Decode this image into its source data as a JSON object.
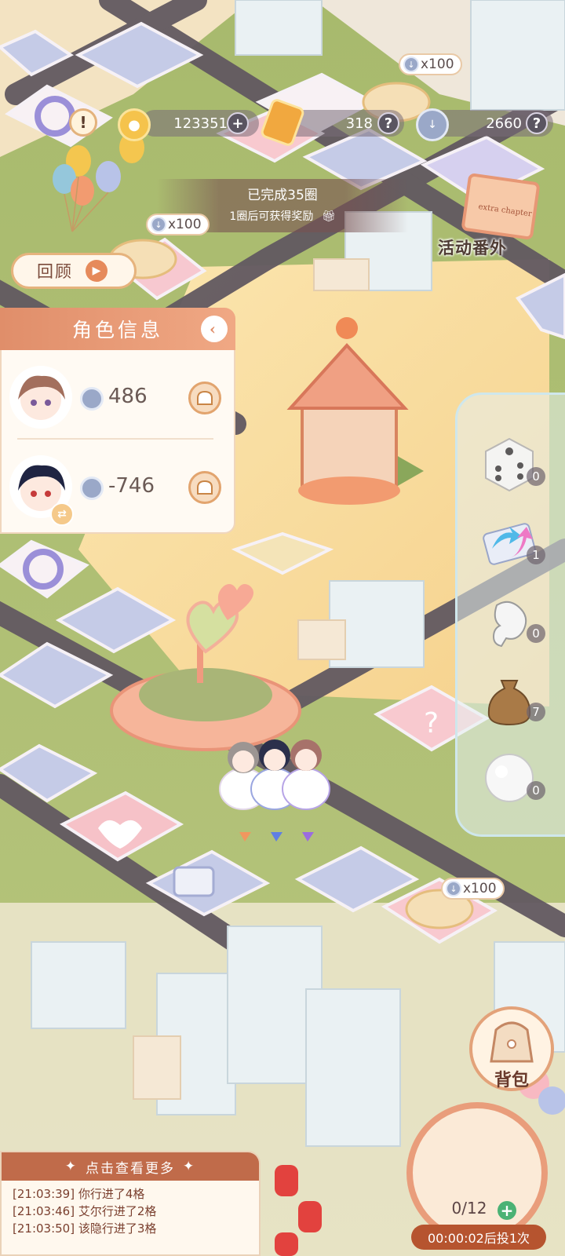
{
  "currency": {
    "coins": "123351",
    "gems": "318",
    "tokens": "2660",
    "add_symbol": "+",
    "help_symbol": "?"
  },
  "progress": {
    "completed_text": "已完成35圈",
    "reward_hint": "1圈后可获得奖励"
  },
  "rewards": {
    "bubble_1": "x100",
    "bubble_2": "x100",
    "bubble_3": "x100"
  },
  "review_button": {
    "label": "回顾"
  },
  "event_badge": {
    "label": "活动番外",
    "art_text": "extra chapter"
  },
  "character_panel": {
    "title": "角色信息",
    "characters": [
      {
        "score": "486"
      },
      {
        "score": "-746"
      }
    ]
  },
  "items": [
    {
      "name": "dice",
      "count": "0"
    },
    {
      "name": "arrow-card",
      "count": "1"
    },
    {
      "name": "glove",
      "count": "0"
    },
    {
      "name": "sack",
      "count": "7"
    },
    {
      "name": "snowball",
      "count": "0"
    }
  ],
  "bag": {
    "label": "背包"
  },
  "roll": {
    "count": "0/12",
    "timer_text": "00:00:02后投1次"
  },
  "log": {
    "header": "点击查看更多",
    "entries": [
      "[21:03:39] 你行进了4格",
      "[21:03:46] 艾尔行进了2格",
      "[21:03:50] 该隐行进了3格"
    ]
  },
  "colors": {
    "ground_yellow": "#f7dca0",
    "grass": "#a7bf6b",
    "road": "#6b6065",
    "accent": "#e08e6a"
  }
}
